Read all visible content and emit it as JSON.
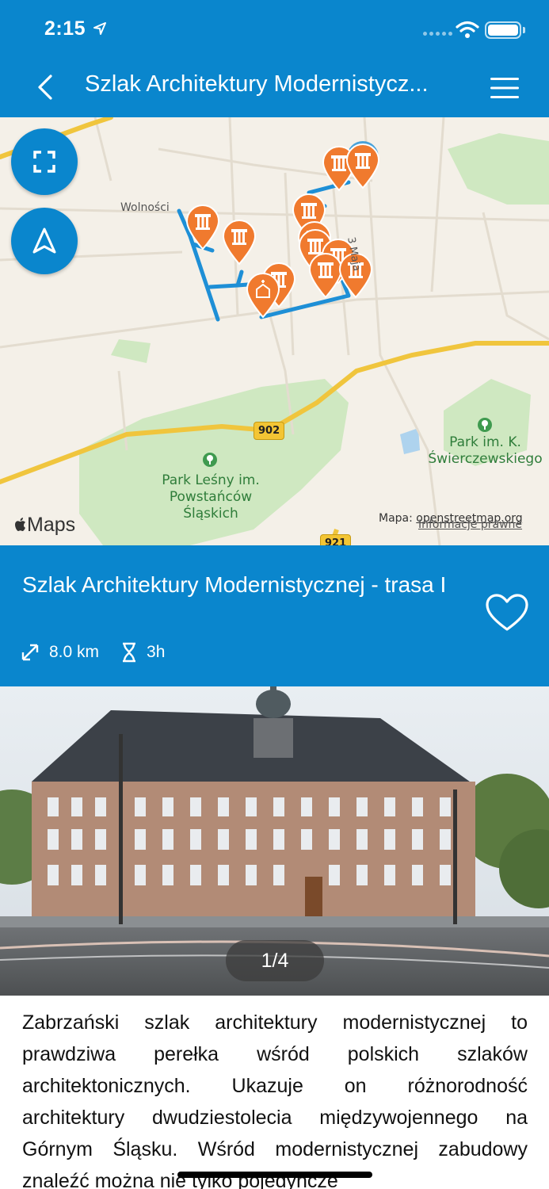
{
  "status_bar": {
    "time": "2:15",
    "icons": [
      "location-arrow-icon",
      "cell-signal-icon",
      "wifi-icon",
      "battery-icon"
    ]
  },
  "nav": {
    "title": "Szlak Architektury Modernistycz...",
    "back_icon": "chevron-left-icon",
    "menu_icon": "hamburger-menu-icon"
  },
  "map": {
    "street_labels": [
      "Wolności",
      "3 Maja"
    ],
    "parks": [
      "Park Leśny im.\nPowstańców\nŚląskich",
      "Park im. K.\nŚwierczewskiego"
    ],
    "road_numbers": [
      "902",
      "921"
    ],
    "apple_maps": "Maps",
    "credit_prefix": "Mapa: ",
    "credit_link": "openstreetmap.org",
    "legal_link": "Informacje prawne",
    "buttons": [
      "fullscreen-icon",
      "navigation-arrow-icon"
    ]
  },
  "route": {
    "title": "Szlak Architektury Modernistycznej - trasa I",
    "distance": "8.0 km",
    "duration": "3h",
    "favorite_icon": "heart-outline-icon"
  },
  "gallery": {
    "pager": "1/4"
  },
  "description": "Zabrzański szlak architektury modernistycznej to prawdziwa perełka wśród polskich szlaków architektonicznych. Ukazuje on różnorodność architektury dwudziestolecia międzywojennego na Górnym Śląsku. Wśród modernistycznej zabudowy znaleźć można nie tylko pojedyncze",
  "colors": {
    "primary": "#0a86cd",
    "marker": "#f07a2e",
    "route_line": "#1e8fd6",
    "park": "#cfe8c1"
  }
}
